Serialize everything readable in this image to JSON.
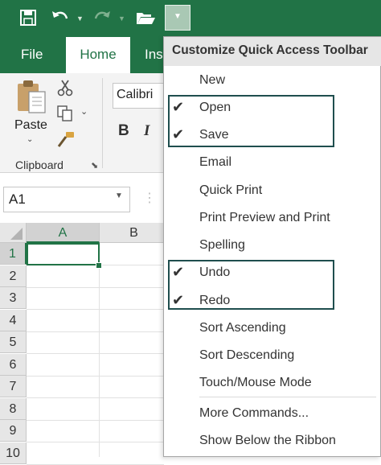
{
  "qat": {
    "save_icon": "save-icon",
    "undo_icon": "undo-icon",
    "redo_icon": "redo-icon",
    "open_icon": "open-folder-icon",
    "dropdown_icon": "chevron-down-icon"
  },
  "tabs": {
    "file": "File",
    "home": "Home",
    "insert_partial": "Inse"
  },
  "ribbon": {
    "paste_label": "Paste",
    "clipboard_label": "Clipboard",
    "font_name": "Calibri",
    "bold": "B",
    "italic": "I"
  },
  "formula_bar": {
    "name_box": "A1"
  },
  "grid": {
    "columns": [
      "A",
      "B"
    ],
    "rows": [
      "1",
      "2",
      "3",
      "4",
      "5",
      "6",
      "7",
      "8",
      "9",
      "10"
    ]
  },
  "menu": {
    "title": "Customize Quick Access Toolbar",
    "items": [
      {
        "label": "New",
        "checked": false
      },
      {
        "label": "Open",
        "checked": true
      },
      {
        "label": "Save",
        "checked": true
      },
      {
        "label": "Email",
        "checked": false
      },
      {
        "label": "Quick Print",
        "checked": false
      },
      {
        "label": "Print Preview and Print",
        "checked": false
      },
      {
        "label": "Spelling",
        "checked": false
      },
      {
        "label": "Undo",
        "checked": true
      },
      {
        "label": "Redo",
        "checked": true
      },
      {
        "label": "Sort Ascending",
        "checked": false
      },
      {
        "label": "Sort Descending",
        "checked": false
      },
      {
        "label": "Touch/Mouse Mode",
        "checked": false
      },
      {
        "label": "More Commands...",
        "checked": false
      },
      {
        "label": "Show Below the Ribbon",
        "checked": false
      }
    ],
    "check_glyph": "✔"
  },
  "colors": {
    "excel_green": "#217346",
    "highlight_border": "#1f4e4e"
  }
}
